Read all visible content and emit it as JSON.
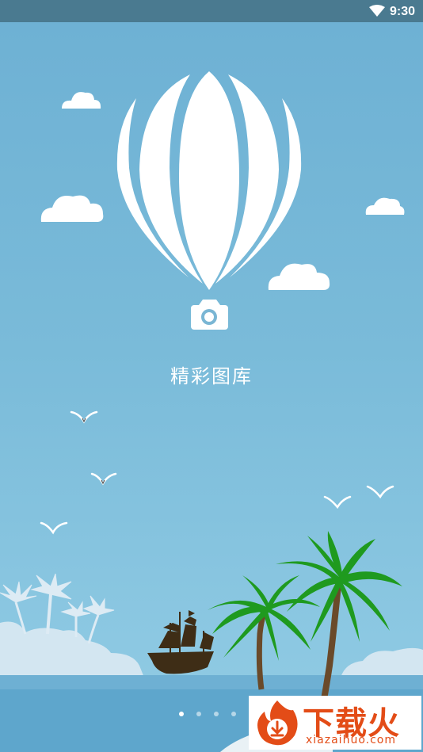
{
  "status_bar": {
    "time": "9:30",
    "icons": [
      "wifi-icon"
    ]
  },
  "splash": {
    "logo_icons": [
      "hot-air-balloon-icon",
      "camera-icon"
    ],
    "app_title": "精彩图库"
  },
  "pager": {
    "total": 5,
    "active_index": 0
  },
  "watermark": {
    "brand": "下载火",
    "domain": "xiazaihuo.com"
  },
  "colors": {
    "status_bar": "#4a7a90",
    "sky_top": "#6eb1d4",
    "sky_bottom": "#92cce4",
    "sea": "#5ea6cc",
    "palm_green": "#1f9a1f",
    "ship": "#3e2d16",
    "watermark_orange": "#e34c17"
  }
}
